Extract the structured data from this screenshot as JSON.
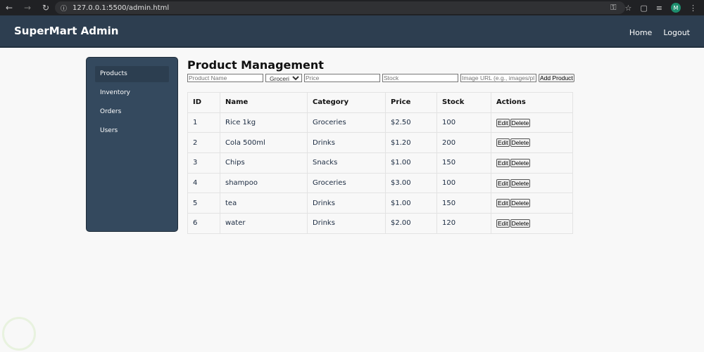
{
  "browser": {
    "url": "127.0.0.1:5500/admin.html",
    "profile_initial": "M"
  },
  "header": {
    "title": "SuperMart Admin",
    "nav": [
      "Home",
      "Logout"
    ]
  },
  "sidebar": {
    "items": [
      {
        "label": "Products",
        "active": true
      },
      {
        "label": "Inventory"
      },
      {
        "label": "Orders"
      },
      {
        "label": "Users"
      }
    ]
  },
  "main": {
    "title": "Product Management",
    "form": {
      "name_placeholder": "Product Name",
      "category_selected": "Groceries",
      "price_placeholder": "Price",
      "stock_placeholder": "Stock",
      "image_placeholder": "Image URL (e.g., images/pl",
      "add_label": "Add Product"
    },
    "table": {
      "headers": [
        "ID",
        "Name",
        "Category",
        "Price",
        "Stock",
        "Actions"
      ],
      "rows": [
        [
          "1",
          "Rice 1kg",
          "Groceries",
          "$2.50",
          "100"
        ],
        [
          "2",
          "Cola 500ml",
          "Drinks",
          "$1.20",
          "200"
        ],
        [
          "3",
          "Chips",
          "Snacks",
          "$1.00",
          "150"
        ],
        [
          "4",
          "shampoo",
          "Groceries",
          "$3.00",
          "100"
        ],
        [
          "5",
          "tea",
          "Drinks",
          "$1.00",
          "150"
        ],
        [
          "6",
          "water",
          "Drinks",
          "$2.00",
          "120"
        ]
      ],
      "edit_label": "Edit",
      "delete_label": "Delete"
    }
  }
}
